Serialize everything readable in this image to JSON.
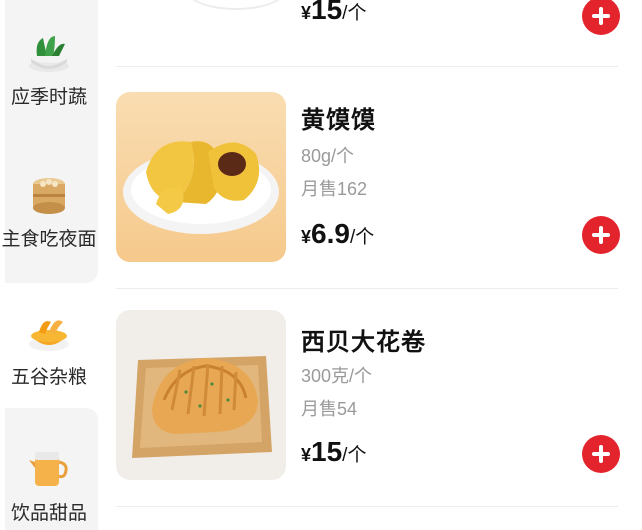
{
  "sidebar": {
    "items": [
      {
        "label": "应季时蔬",
        "icon": "vegetable-bowl-icon",
        "active": false
      },
      {
        "label": "主食吃夜面",
        "icon": "steamed-bun-basket-icon",
        "active": false
      },
      {
        "label": "五谷杂粮",
        "icon": "grain-bowl-icon",
        "active": true
      },
      {
        "label": "饮品甜品",
        "icon": "drink-jug-icon",
        "active": false
      }
    ]
  },
  "products": [
    {
      "price": {
        "currency": "¥",
        "value": "15",
        "unit": "/个"
      }
    },
    {
      "name": "黄馍馍",
      "spec": "80g/个",
      "sales": "月售162",
      "price": {
        "currency": "¥",
        "value": "6.9",
        "unit": "/个"
      },
      "image": "yellow-steamed-bun-image"
    },
    {
      "name": "西贝大花卷",
      "spec": "300克/个",
      "sales": "月售54",
      "price": {
        "currency": "¥",
        "value": "15",
        "unit": "/个"
      },
      "image": "flower-roll-bread-image"
    }
  ],
  "colors": {
    "accent": "#e4242d",
    "muted": "#9a9a9a",
    "sidebar_bg": "#f4f4f4"
  }
}
